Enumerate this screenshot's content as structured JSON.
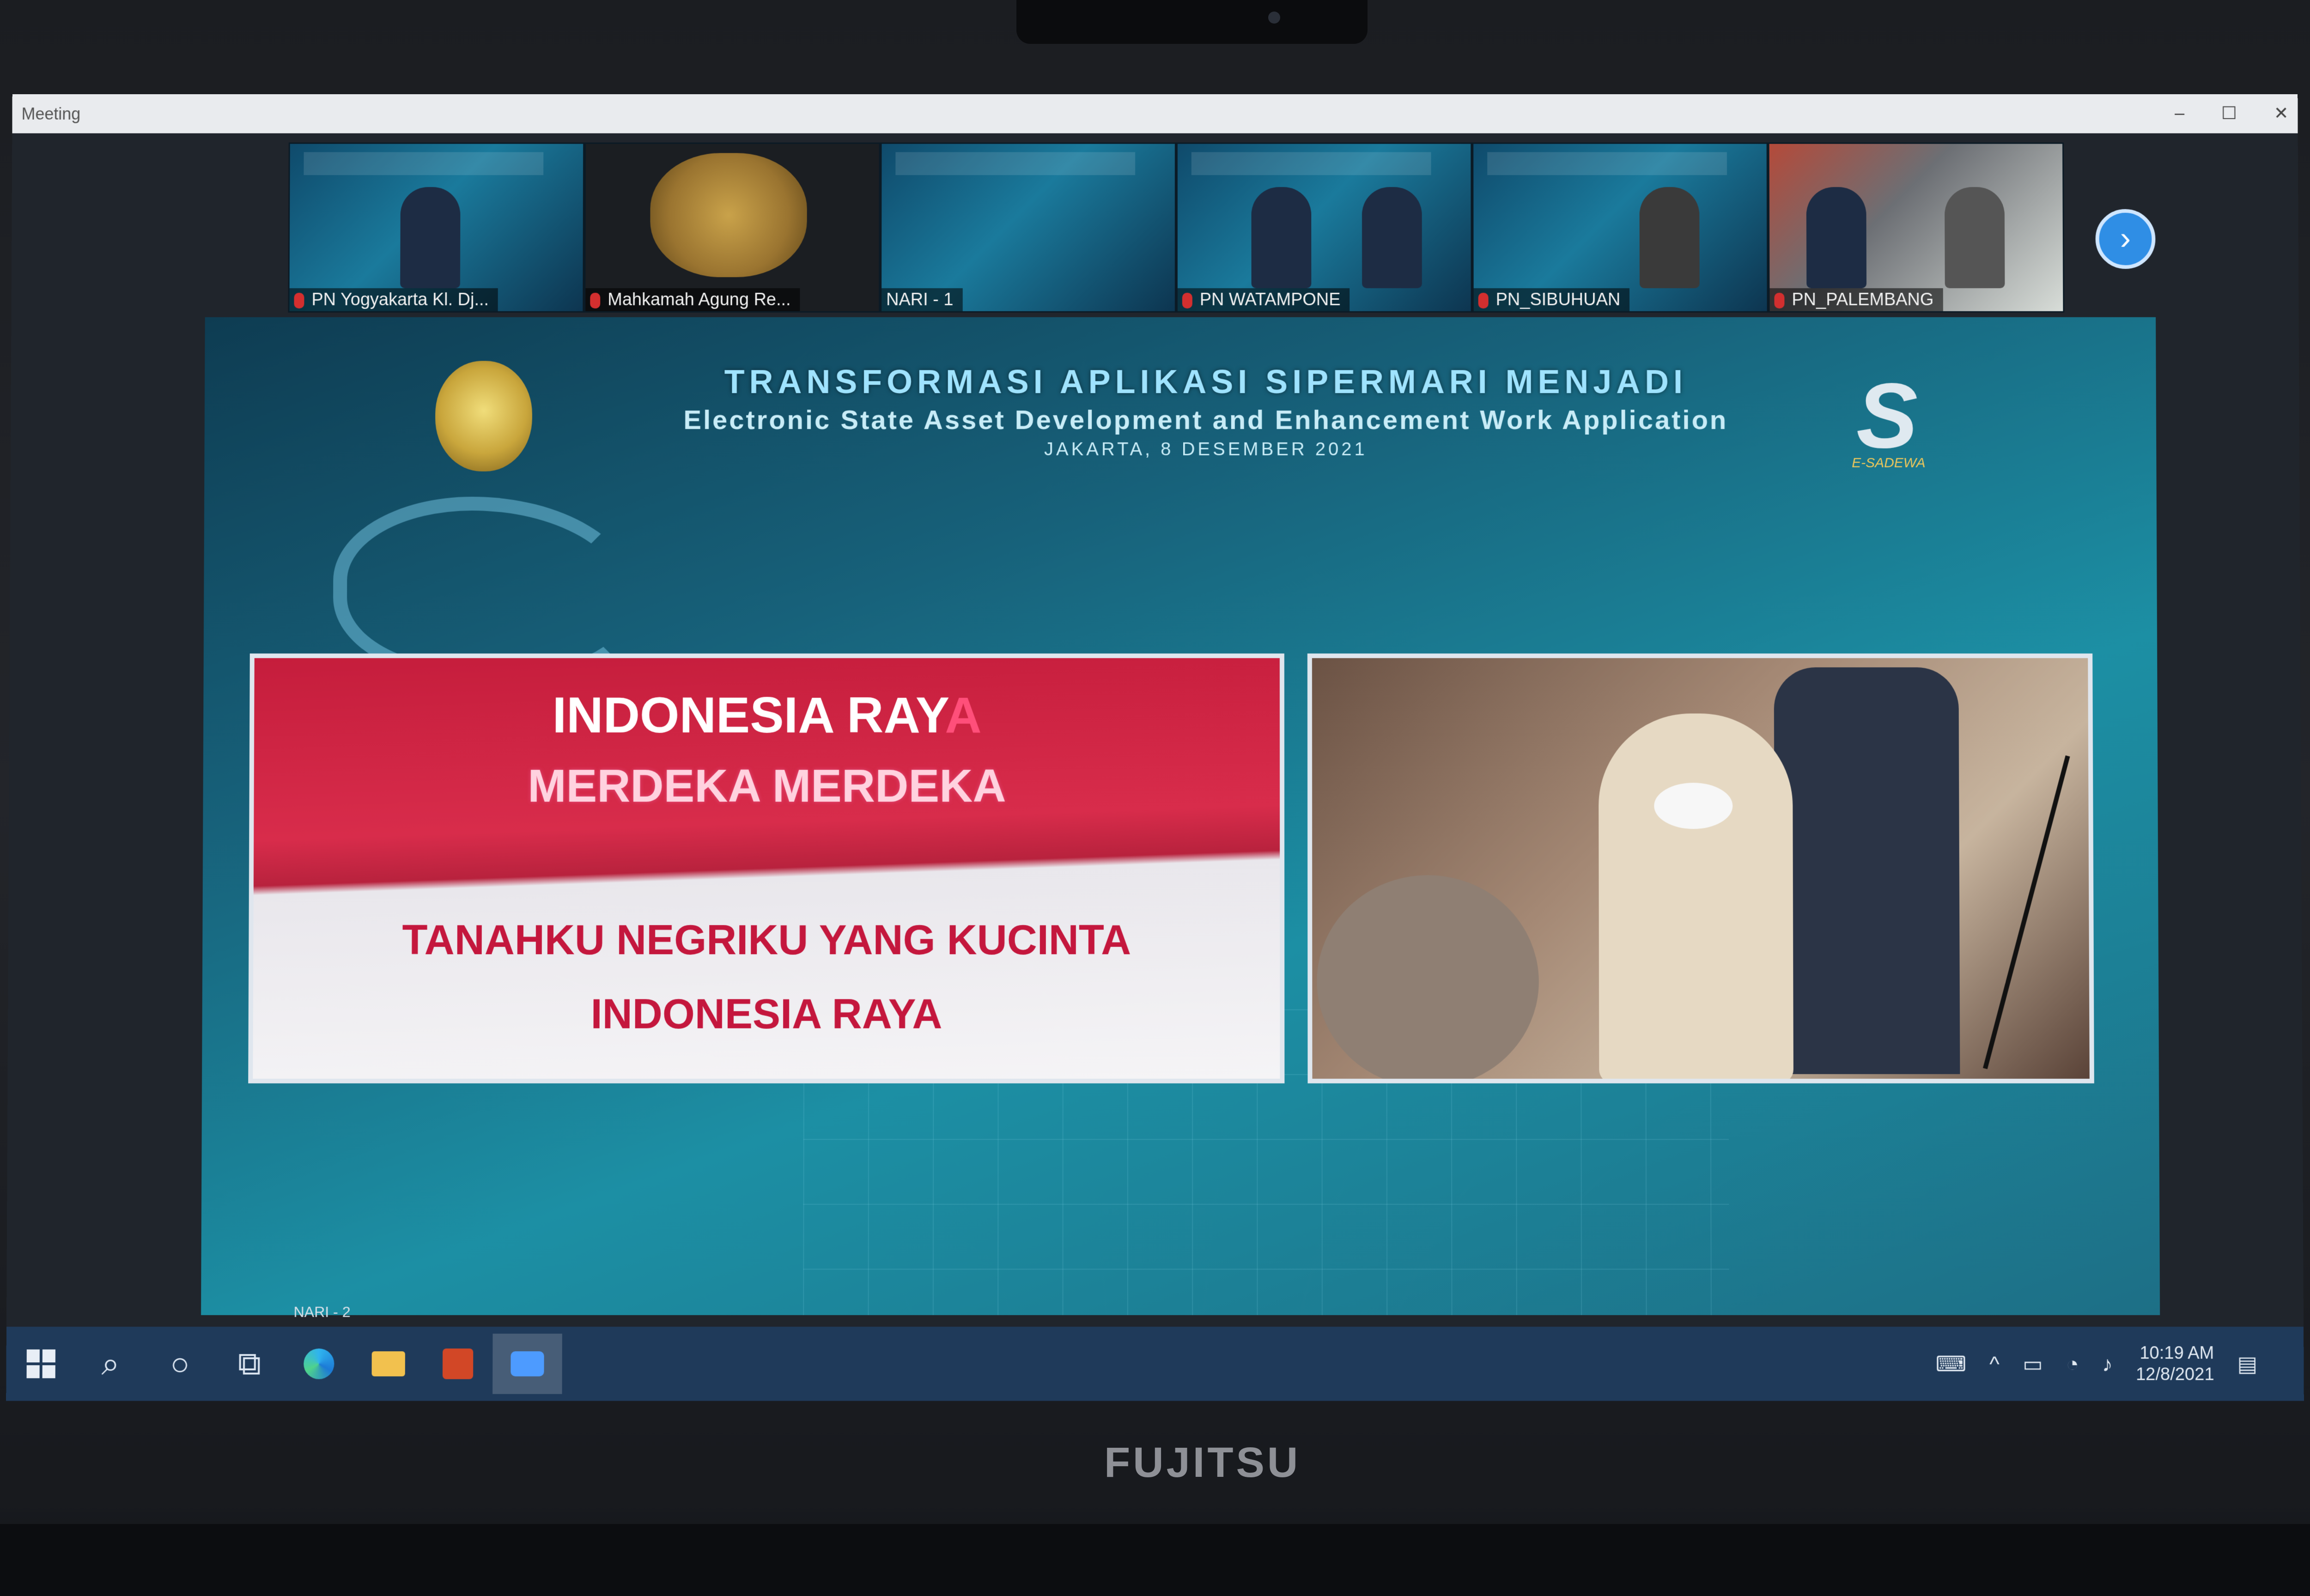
{
  "window": {
    "title": "Meeting",
    "controls": [
      "–",
      "☐",
      "✕"
    ]
  },
  "participants": [
    {
      "name": "PN Yogyakarta Kl. Dj...",
      "type": "room"
    },
    {
      "name": "Mahkamah Agung Re...",
      "type": "logo"
    },
    {
      "name": "NARI - 1",
      "type": "room"
    },
    {
      "name": "PN WATAMPONE",
      "type": "room"
    },
    {
      "name": "PN_SIBUHUAN",
      "type": "room"
    },
    {
      "name": "PN_PALEMBANG",
      "type": "venue"
    }
  ],
  "next_page": "›",
  "presentation": {
    "title": "TRANSFORMASI APLIKASI SIPERMARI MENJADI",
    "subtitle": "Electronic State Asset Development and Enhancement Work Application",
    "date": "JAKARTA, 8 DESEMBER 2021",
    "logo_text": "E-SADEWA",
    "lyrics": {
      "line1_main": "INDONESIA RAY",
      "line1_tail": "A",
      "line2": "MERDEKA MERDEKA",
      "line3": "TANAHKU NEGRIKU YANG KUCINTA",
      "line4": "INDONESIA RAYA"
    }
  },
  "speaker_tag": "NARI - 2",
  "taskbar": {
    "time": "10:19 AM",
    "date": "12/8/2021",
    "icons": [
      "windows-start-icon",
      "search-icon",
      "task-view-icon",
      "people-icon",
      "edge-icon",
      "file-explorer-icon",
      "powerpoint-icon",
      "zoom-icon"
    ]
  },
  "laptop_brand": "FUJITSU"
}
